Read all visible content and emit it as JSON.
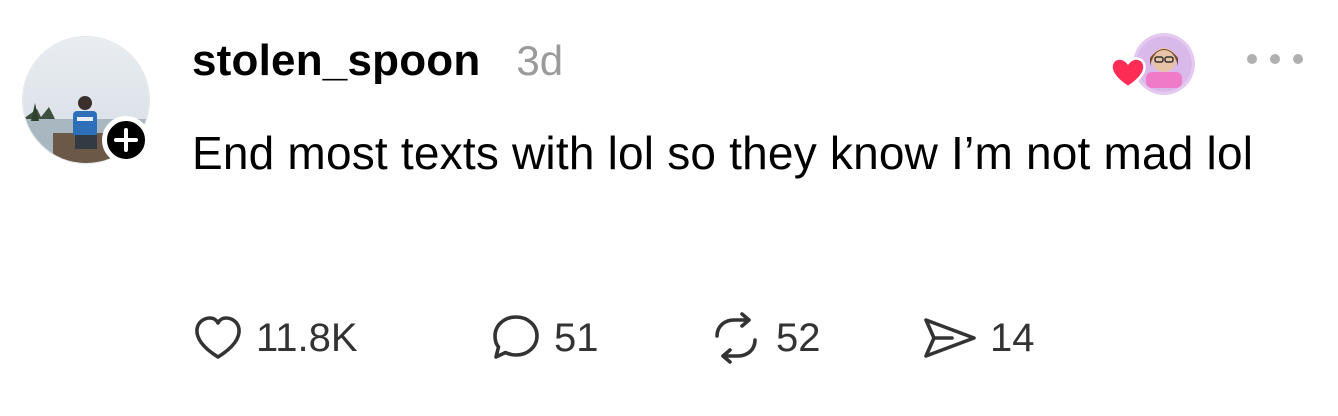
{
  "post": {
    "username": "stolen_spoon",
    "timestamp": "3d",
    "text": "End most texts with lol so they know I’m not mad lol"
  },
  "actions": {
    "likes": "11.8K",
    "replies": "51",
    "reposts": "52",
    "shares": "14"
  },
  "icons": {
    "like": "heart-outline-icon",
    "reply": "speech-bubble-icon",
    "repost": "repost-arrows-icon",
    "share": "paper-plane-icon",
    "follow": "plus-icon",
    "more": "ellipsis-icon",
    "liked_by_heart": "heart-filled-icon"
  },
  "colors": {
    "heart": "#ff2d55",
    "muted_text": "#9a9a9a",
    "icon": "#333333"
  }
}
